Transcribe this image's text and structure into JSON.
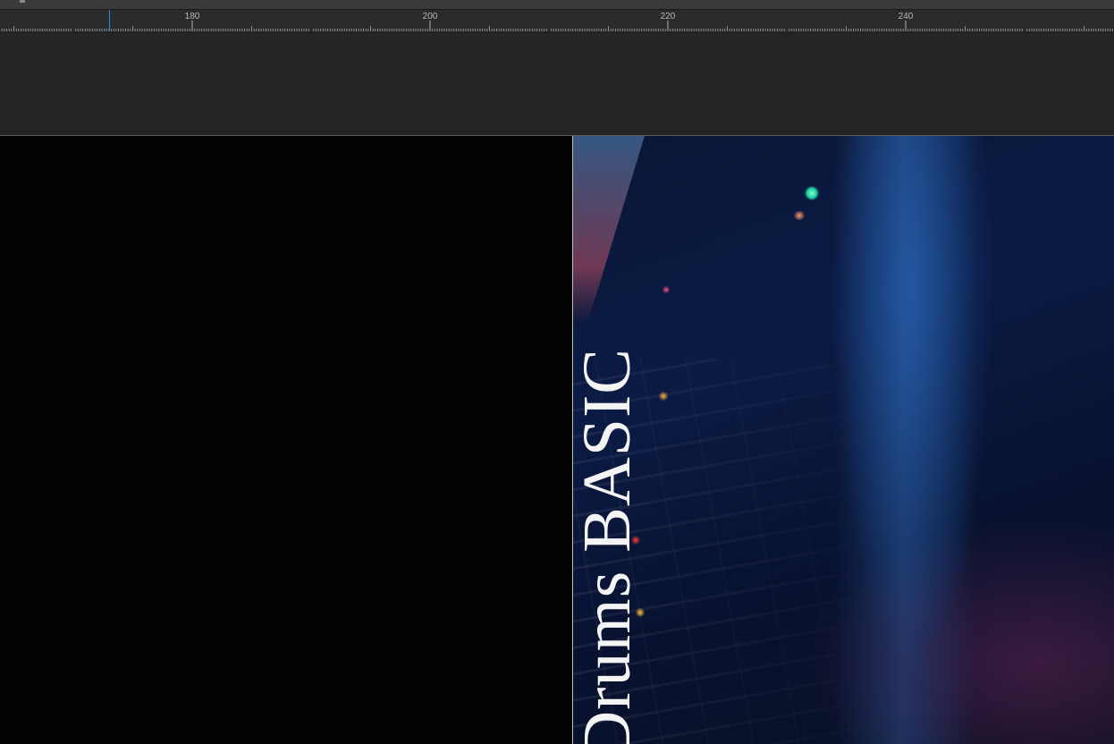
{
  "ruler": {
    "ticks": [
      {
        "label": "180",
        "value": 180
      },
      {
        "label": "200",
        "value": 200
      },
      {
        "label": "220",
        "value": 220
      },
      {
        "label": "240",
        "value": 240
      }
    ],
    "playhead_value": 173
  },
  "preview": {
    "overlay_text": "Drums BASIC"
  },
  "colors": {
    "playhead": "#2e8ce0",
    "ruler_bg": "#2b2b2b",
    "track_bg": "#252525",
    "preview_bg": "#030303",
    "overlay_text": "#f4f4f4"
  },
  "icons": {
    "playhead": "playhead-marker-icon"
  }
}
